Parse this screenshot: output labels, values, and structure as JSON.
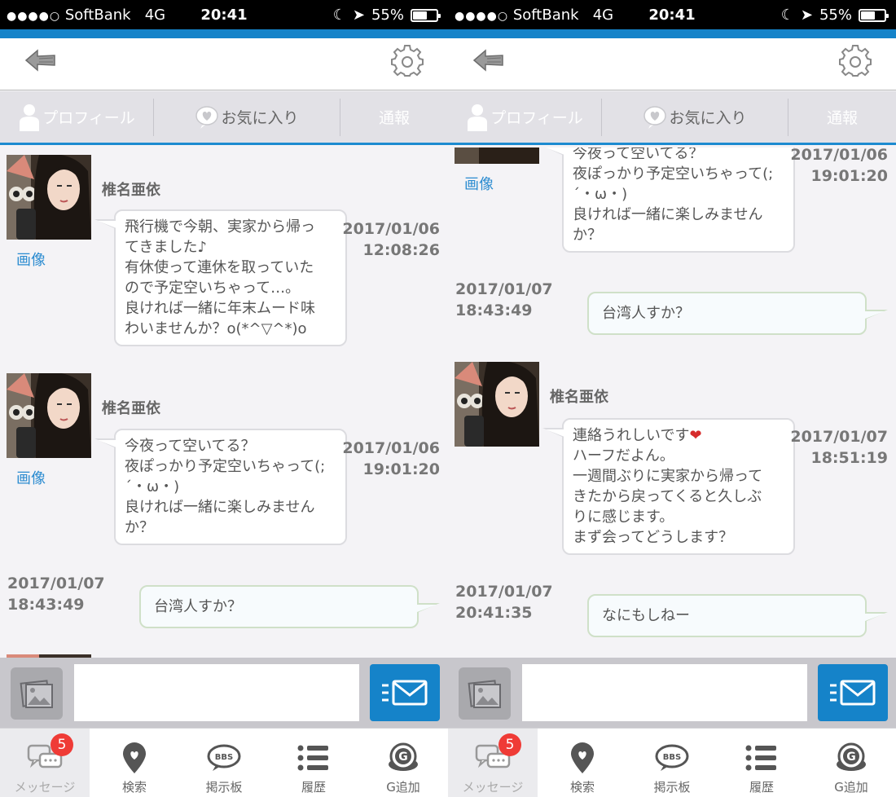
{
  "status_bar": {
    "signal": "●●●●○",
    "carrier": "SoftBank",
    "network": "4G",
    "time": "20:41",
    "battery_text": "55%",
    "battery_level": 0.55
  },
  "tabs": {
    "profile": "プロフィール",
    "favorite": "お気に入り",
    "report": "通報"
  },
  "sender": {
    "name": "椎名亜依",
    "image_link": "画像"
  },
  "messages": {
    "m1": {
      "date": "2017/01/06",
      "time": "12:08:26",
      "lines": [
        " 飛行機で今朝、実家から帰っ",
        "てきました♪",
        "有休使って連休を取っていた",
        "ので予定空いちゃって…。",
        "良ければ一緒に年末ムード味",
        "わいませんか？o(*^▽^*)o"
      ]
    },
    "m2": {
      "date": "2017/01/06",
      "time": "19:01:20",
      "lines": [
        " 今夜って空いてる？",
        "夜ぽっかり予定空いちゃって(;",
        "´・ω・)",
        "良ければ一緒に楽しみません",
        "か？"
      ]
    },
    "m3": {
      "date": "2017/01/07",
      "time": "18:43:49",
      "text": "台湾人すか？"
    },
    "m4": {
      "date": "2017/01/07",
      "time": "18:51:19",
      "line1": " 連絡うれしいです",
      "heart": "❤",
      "lines": [
        "ハーフだよん。",
        "一週間ぶりに実家から帰って",
        "きたから戻ってくると久しぶ",
        "りに感じます。",
        "まず会ってどうします？"
      ]
    },
    "m5": {
      "date": "2017/01/07",
      "time": "20:41:35",
      "text": "なにもしねー"
    }
  },
  "composer": {
    "value": "",
    "placeholder": ""
  },
  "nav": {
    "messages": "メッセージ",
    "search": "検索",
    "bbs": "掲示板",
    "history": "履歴",
    "add_g": "G追加",
    "badge_count": "5",
    "bbs_icon_text": "BBS",
    "g_icon_text": "G"
  },
  "colors": {
    "accent": "#1583c9",
    "badge": "#ef3b36",
    "link": "#2a8bd0"
  }
}
